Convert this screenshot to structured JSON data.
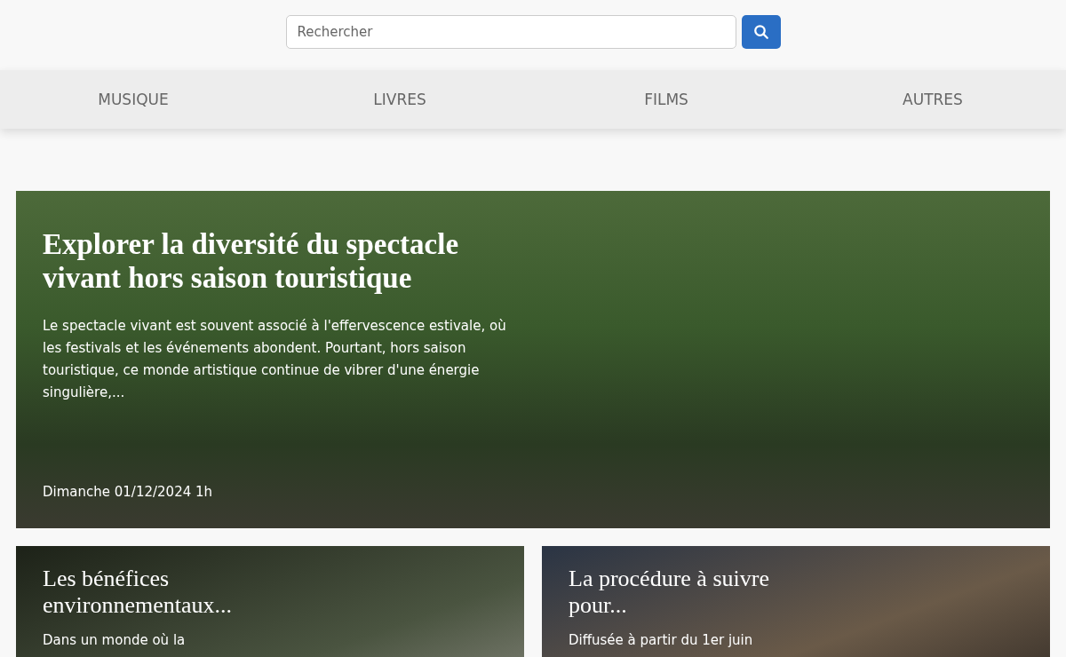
{
  "search": {
    "placeholder": "Rechercher"
  },
  "nav": [
    {
      "label": "MUSIQUE"
    },
    {
      "label": "LIVRES"
    },
    {
      "label": "FILMS"
    },
    {
      "label": "AUTRES"
    }
  ],
  "featured": {
    "title": "Explorer la diversité du spectacle vivant hors saison touristique",
    "excerpt": "Le spectacle vivant est souvent associé à l'effervescence estivale, où les festivals et les événements abondent. Pourtant, hors saison touristique, ce monde artistique continue de vibrer d'une énergie singulière,...",
    "date": "Dimanche 01/12/2024 1h"
  },
  "articles": [
    {
      "title": "Les bénéfices environnementaux...",
      "excerpt": "Dans un monde où la"
    },
    {
      "title": "La procédure à suivre pour...",
      "excerpt": "Diffusée à partir du 1er juin"
    }
  ]
}
